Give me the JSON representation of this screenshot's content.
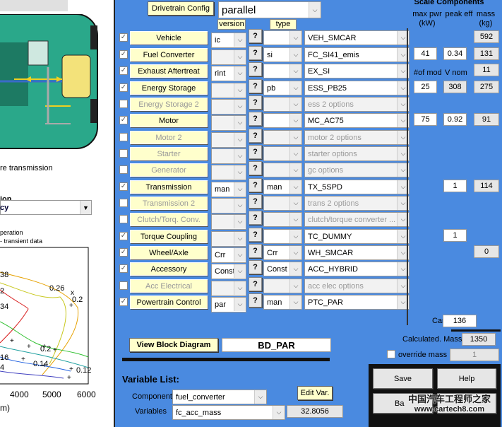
{
  "left_panel": {
    "transmission_label": "re transmission",
    "section_title_1": "ion",
    "section_title_2": "cy",
    "legend_1": "peration",
    "legend_2": "- transient data",
    "contour_labels": [
      "38",
      "2",
      "34",
      "0.26",
      "0.2",
      "0.2",
      "16",
      "0.2",
      "4",
      "0.14",
      "0.12"
    ],
    "x_ticks": [
      "4000",
      "5000",
      "6000"
    ],
    "x_unit": "m)"
  },
  "header": {
    "drivetrain_config_label": "Drivetrain Config",
    "drivetrain_value": "parallel",
    "version_label": "version",
    "type_label": "type",
    "scale_components": "Scale Components",
    "max_pwr": "max pwr",
    "max_pwr_unit": "(kW)",
    "peak_eff": "peak eff",
    "mass": "mass",
    "mass_unit": "(kg)"
  },
  "components": [
    {
      "name": "Vehicle",
      "checked": true,
      "enabled": true,
      "version": "ic",
      "type": "",
      "model": "VEH_SMCAR",
      "mass": "592"
    },
    {
      "name": "Fuel Converter",
      "checked": true,
      "enabled": true,
      "version": "",
      "type": "si",
      "model": "FC_SI41_emis",
      "pwr": "41",
      "eff": "0.34",
      "mass": "131"
    },
    {
      "name": "Exhaust Aftertreat",
      "checked": true,
      "enabled": true,
      "version": "rint",
      "type": "",
      "model": "EX_SI",
      "mod_label": "#of mod",
      "vnom_label": "V nom",
      "mass": "11"
    },
    {
      "name": "Energy Storage",
      "checked": true,
      "enabled": true,
      "version": "",
      "type": "pb",
      "model": "ESS_PB25",
      "pwr": "25",
      "eff": "308",
      "mass": "275"
    },
    {
      "name": "Energy Storage 2",
      "checked": false,
      "enabled": false,
      "version": "",
      "type": "",
      "model": "ess 2 options"
    },
    {
      "name": "Motor",
      "checked": true,
      "enabled": true,
      "version": "",
      "type": "",
      "model": "MC_AC75",
      "pwr": "75",
      "eff": "0.92",
      "mass": "91"
    },
    {
      "name": "Motor 2",
      "checked": false,
      "enabled": false,
      "version": "",
      "type": "",
      "model": "motor 2 options"
    },
    {
      "name": "Starter",
      "checked": false,
      "enabled": false,
      "version": "",
      "type": "",
      "model": "starter options"
    },
    {
      "name": "Generator",
      "checked": false,
      "enabled": false,
      "version": "",
      "type": "",
      "model": "gc options"
    },
    {
      "name": "Transmission",
      "checked": true,
      "enabled": true,
      "version": "man",
      "type": "man",
      "model": "TX_5SPD",
      "eff": "1",
      "mass": "114"
    },
    {
      "name": "Transmission 2",
      "checked": false,
      "enabled": false,
      "version": "",
      "type": "",
      "model": "trans 2 options"
    },
    {
      "name": "Clutch/Torq. Conv.",
      "checked": false,
      "enabled": false,
      "version": "",
      "type": "",
      "model": "clutch/torque converter ..."
    },
    {
      "name": "Torque Coupling",
      "checked": true,
      "enabled": true,
      "version": "",
      "type": "",
      "model": "TC_DUMMY",
      "eff": "1"
    },
    {
      "name": "Wheel/Axle",
      "checked": true,
      "enabled": true,
      "version": "Crr",
      "type": "Crr",
      "model": "WH_SMCAR",
      "mass": "0"
    },
    {
      "name": "Accessory",
      "checked": true,
      "enabled": true,
      "version": "Const",
      "type": "Const",
      "model": "ACC_HYBRID"
    },
    {
      "name": "Acc Electrical",
      "checked": false,
      "enabled": false,
      "version": "",
      "type": "",
      "model": "acc elec options"
    },
    {
      "name": "Powertrain Control",
      "checked": true,
      "enabled": true,
      "version": "par",
      "type": "man",
      "model": "PTC_PAR"
    }
  ],
  "cargo": {
    "label": "Cargo",
    "value": "136"
  },
  "calculated_mass": {
    "label": "Calculated. Mass",
    "value": "1350"
  },
  "override_mass": {
    "label": "override mass",
    "value": "1"
  },
  "block_diagram": {
    "button_label": "View Block Diagram",
    "value": "BD_PAR"
  },
  "variable_list": {
    "title": "Variable List:",
    "component_label": "Component",
    "component_value": "fuel_converter",
    "variables_label": "Variables",
    "variables_value": "fc_acc_mass",
    "edit_label": "Edit Var.",
    "value": "32.8056"
  },
  "actions": {
    "save": "Save",
    "help": "Help",
    "back": "Ba"
  },
  "watermark": {
    "line1": "中国汽车工程师之家",
    "line2": "www.cartech8.com"
  },
  "colors": {
    "panel_bg": "#4a8ae0",
    "button_face": "#ffffcc",
    "car_body": "#2aa88a"
  }
}
